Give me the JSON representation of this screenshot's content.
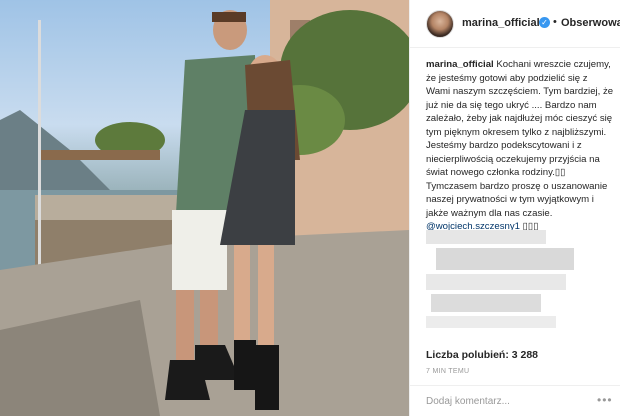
{
  "post": {
    "username": "marina_official",
    "verified_icon": "verified-badge-icon",
    "separator": "•",
    "follow_label": "Obserwowanie",
    "caption_username": "marina_official",
    "caption_text": "Kochani wreszcie czujemy, że jesteśmy gotowi aby podzielić się z Wami naszym szczęściem. Tym bardziej, że już nie da się tego ukryć .... Bardzo nam zależało, żeby jak najdłużej móc cieszyć się tym pięknym okresem tylko z najbliższymi. Jesteśmy bardzo podekscytowani i z niecierpliwością oczekujemy przyjścia na świat nowego członka rodziny.▯▯ Tymczasem bardzo proszę o uszanowanie naszej prywatności w tym wyjątkowym i jakże ważnym dla nas czasie.",
    "mention": "@wojciech.szczesny1",
    "mention_suffix": " ▯▯▯",
    "likes_text": "Liczba polubień: 3 288",
    "time_text": "7 MIN TEMU",
    "comment_placeholder": "Dodaj komentarz...",
    "more_icon": "more-options-icon"
  },
  "colors": {
    "link": "#003569",
    "verified": "#3897f0",
    "muted": "#999999"
  }
}
